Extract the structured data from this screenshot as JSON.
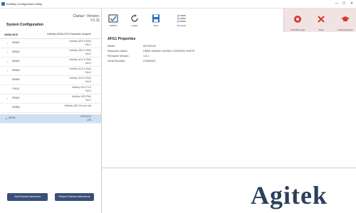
{
  "titlebar": {
    "title": "Keithley Configuration Utility"
  },
  "header": {
    "version": "Clarius⁺ Version: V1.11",
    "section_title": "System Configuration",
    "toolbar": [
      {
        "label": "ValidSet",
        "icon": "validate-icon"
      },
      {
        "label": "update",
        "icon": "refresh-icon"
      },
      {
        "label": "Save",
        "icon": "save-icon"
      },
      {
        "label": "Summary",
        "icon": "summary-list-icon"
      }
    ],
    "right_toolbar": [
      {
        "label": "KXCI/SCI Logs",
        "icon": "lifebuoy-icon"
      },
      {
        "label": "Tools",
        "icon": "tools-icon"
      },
      {
        "label": "Learning Center",
        "icon": "graduation-cap-icon"
      }
    ],
    "accent_red": "#d63a2a",
    "accent_blue": "#2d6db5"
  },
  "tree": {
    "root": {
      "name": "4200A-SCS",
      "desc": "Keithley 4200A-SCS Parameter Analyzer"
    },
    "items": [
      {
        "name": "SMU1",
        "desc1": "Keithley 4200 H SMU",
        "desc2": "Slot 1",
        "expandable": true
      },
      {
        "name": "SMU2",
        "desc1": "Keithley 4200 H SMU",
        "desc2": "Slot 2",
        "expandable": true
      },
      {
        "name": "SMU3",
        "desc1": "Keithley 4210 H SMU",
        "desc2": "Slot 3",
        "expandable": true
      },
      {
        "name": "SMU4",
        "desc1": "Keithley 4210 H SMU",
        "desc2": "Slot 4",
        "expandable": true
      },
      {
        "name": "SMU5",
        "desc1": "Keithley 4210 H SMU",
        "desc2": "Slot 6",
        "expandable": false
      },
      {
        "name": "CVU1",
        "desc1": "Keithley 4210 CVU",
        "desc2": "Slot 5",
        "expandable": false
      },
      {
        "name": "PMU1",
        "desc1": "Keithley 4225 PMU",
        "desc2": "Slot 2",
        "expandable": true
      },
      {
        "name": "GNDU",
        "desc1": "Keithley 4200 Ground Unit",
        "desc2": "",
        "expandable": false
      }
    ],
    "selected": {
      "name": "AFG1",
      "desc1": "AFG31102",
      "desc2": "LAN"
    }
  },
  "buttons": {
    "add_instrument": "Add External Instrument",
    "restore_instruments": "Restore External Instruments"
  },
  "properties": {
    "title": "AFG1 Properties",
    "rows": [
      {
        "key": "Model:",
        "value": "AFG31102"
      },
      {
        "key": "Resource Name:",
        "value": "USB0::0x0699::0x0354::C0000002::INSTR"
      },
      {
        "key": "Firmware Version:",
        "value": "1.6.1"
      },
      {
        "key": "Serial Number:",
        "value": "C0000002"
      }
    ]
  },
  "watermark": "Agitek"
}
